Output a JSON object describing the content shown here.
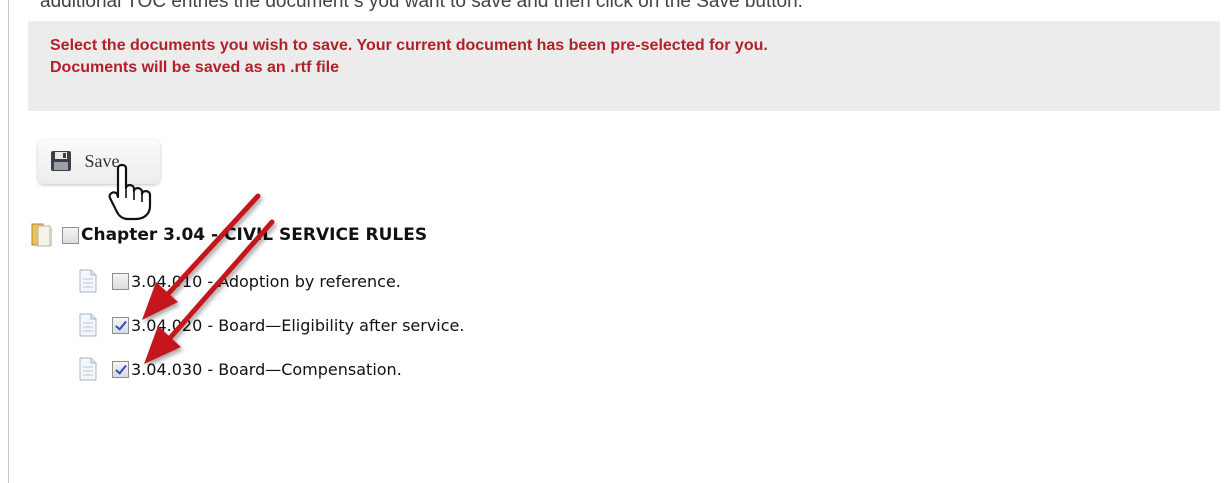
{
  "top_cut_text": "additional TOC entries the document s you want to save and then click on the Save button.",
  "notice": {
    "line1": "Select the documents you wish to save. Your current document has been pre-selected for you.",
    "line2": "Documents will be saved as an .rtf file"
  },
  "toolbar": {
    "save_label": "Save"
  },
  "tree": {
    "chapter": {
      "label": "Chapter 3.04 - CIVIL SERVICE RULES",
      "checked": false
    },
    "sections": [
      {
        "label": "3.04.010 - Adoption by reference.",
        "checked": false
      },
      {
        "label": "3.04.020 - Board—Eligibility after service.",
        "checked": true
      },
      {
        "label": "3.04.030 - Board—Compensation.",
        "checked": true
      }
    ]
  },
  "colors": {
    "notice_text": "#b3202a",
    "notice_bg": "#ececec",
    "arrow": "#c4161c",
    "check": "#2a52c4"
  },
  "icons": {
    "save": "floppy-disk-icon",
    "chapter": "folder-book-icon",
    "section": "document-icon",
    "cursor": "pointing-hand-cursor-icon",
    "annotation": "red-arrow-icon"
  }
}
